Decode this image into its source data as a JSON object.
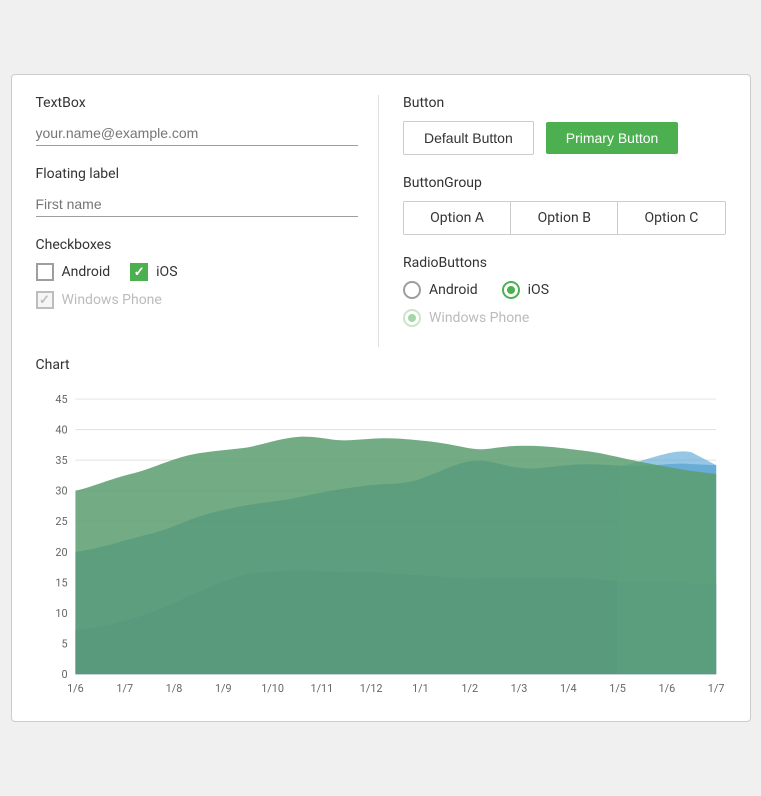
{
  "left": {
    "textbox_title": "TextBox",
    "textbox_placeholder": "your.name@example.com",
    "floating_title": "Floating label",
    "floating_placeholder": "First name",
    "checkboxes_title": "Checkboxes",
    "checkboxes": [
      {
        "label": "Android",
        "checked": false,
        "disabled": false
      },
      {
        "label": "iOS",
        "checked": true,
        "disabled": false
      }
    ],
    "checkbox_disabled": {
      "label": "Windows Phone",
      "checked": true,
      "disabled": true
    }
  },
  "right": {
    "button_title": "Button",
    "default_button_label": "Default Button",
    "primary_button_label": "Primary Button",
    "buttongroup_title": "ButtonGroup",
    "buttongroup_options": [
      "Option A",
      "Option B",
      "Option C"
    ],
    "radio_title": "RadioButtons",
    "radios": [
      {
        "label": "Android",
        "checked": false,
        "disabled": false
      },
      {
        "label": "iOS",
        "checked": true,
        "disabled": false
      }
    ],
    "radio_disabled": {
      "label": "Windows Phone",
      "checked": true,
      "disabled": true
    }
  },
  "chart": {
    "title": "Chart",
    "x_labels": [
      "1/6",
      "1/7",
      "1/8",
      "1/9",
      "1/10",
      "1/11",
      "1/12",
      "1/1",
      "1/2",
      "1/3",
      "1/4",
      "1/5",
      "1/6",
      "1/7"
    ],
    "y_labels": [
      "0",
      "5",
      "10",
      "15",
      "20",
      "25",
      "30",
      "35",
      "40",
      "45"
    ],
    "colors": {
      "green": "#5a9e6f",
      "blue": "#4a90c4",
      "blue_light": "#6ab0db",
      "purple": "#5547a0"
    }
  }
}
